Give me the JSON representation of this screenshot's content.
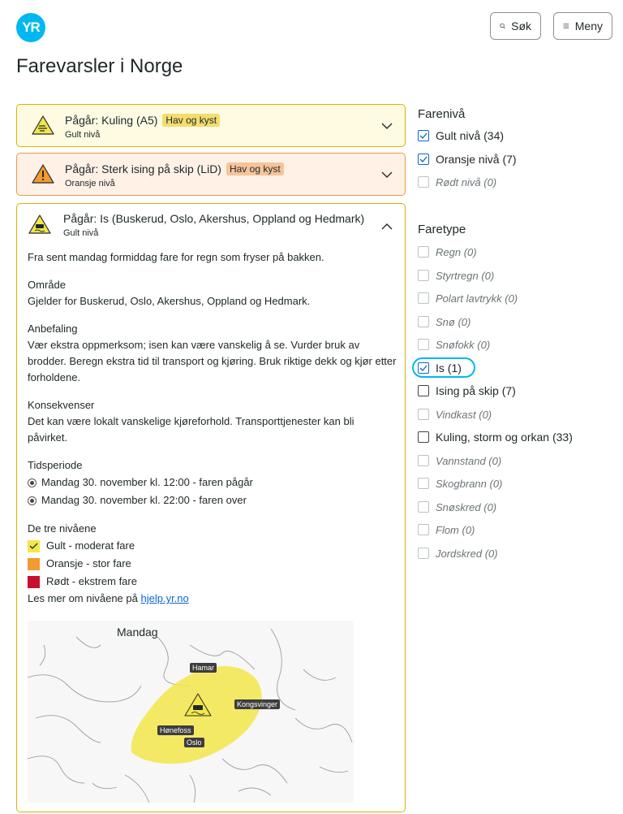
{
  "header": {
    "logo_text": "YR",
    "search_label": "Søk",
    "menu_label": "Meny",
    "page_title": "Farevarsler i Norge"
  },
  "warnings": [
    {
      "prefix": "Pågår: Kuling (A5)",
      "tag": "Hav og kyst",
      "level": "Gult nivå",
      "icon": "wind-warning-icon",
      "color": "#f2dd6e"
    },
    {
      "prefix": "Pågår: Sterk ising på skip (LiD)",
      "tag": "Hav og kyst",
      "level": "Oransje nivå",
      "icon": "ice-ship-warning-icon",
      "color": "#f29b2e"
    },
    {
      "prefix": "Pågår: Is (Buskerud, Oslo, Akershus, Oppland og Hedmark)",
      "level": "Gult nivå",
      "icon": "slippery-road-warning-icon",
      "color": "#f2dd6e",
      "description": "Fra sent mandag formiddag fare for regn som fryser på bakken.",
      "area_heading": "Område",
      "area_text": "Gjelder for Buskerud, Oslo, Akershus, Oppland og Hedmark.",
      "rec_heading": "Anbefaling",
      "rec_text": "Vær ekstra oppmerksom; isen kan være vanskelig å se. Vurder bruk av brodder. Beregn ekstra tid til transport og kjøring. Bruk riktige dekk og kjør etter forholdene.",
      "cons_heading": "Konsekvenser",
      "cons_text": "Det kan være lokalt vanskelige kjøreforhold. Transporttjenester kan bli påvirket.",
      "period_heading": "Tidsperiode",
      "period_start": "Mandag 30. november kl. 12:00 - faren pågår",
      "period_end": "Mandag 30. november kl. 22:00 - faren over",
      "levels_heading": "De tre nivåene",
      "level_yellow": "Gult - moderat fare",
      "level_orange": "Oransje - stor fare",
      "level_red": "Rødt - ekstrem fare",
      "more_text": "Les mer om nivåene på",
      "more_link": "hjelp.yr.no",
      "map_title": "Mandag",
      "cities": {
        "hamar": "Hamar",
        "kongsvinger": "Kongsvinger",
        "honefoss": "Hønefoss",
        "oslo": "Oslo"
      }
    }
  ],
  "filters": {
    "level_heading": "Farenivå",
    "levels": [
      {
        "label": "Gult nivå (34)",
        "checked": true
      },
      {
        "label": "Oransje nivå (7)",
        "checked": true
      },
      {
        "label": "Rødt nivå (0)",
        "checked": false
      }
    ],
    "type_heading": "Faretype",
    "types": [
      {
        "label": "Regn (0)"
      },
      {
        "label": "Styrtregn (0)"
      },
      {
        "label": "Polart lavtrykk (0)"
      },
      {
        "label": "Snø (0)"
      },
      {
        "label": "Snøfokk (0)"
      },
      {
        "label": "Is (1)",
        "checked": true
      },
      {
        "label": "Ising på skip (7)"
      },
      {
        "label": "Vindkast (0)"
      },
      {
        "label": "Kuling, storm og orkan (33)"
      },
      {
        "label": "Vannstand (0)"
      },
      {
        "label": "Skogbrann (0)"
      },
      {
        "label": "Snøskred (0)"
      },
      {
        "label": "Flom (0)"
      },
      {
        "label": "Jordskred (0)"
      }
    ]
  },
  "colors": {
    "brand": "#00b8f1",
    "yellow": "#f3e64a",
    "orange": "#f29b2e",
    "red": "#c8102e",
    "link": "#0b66d4"
  }
}
